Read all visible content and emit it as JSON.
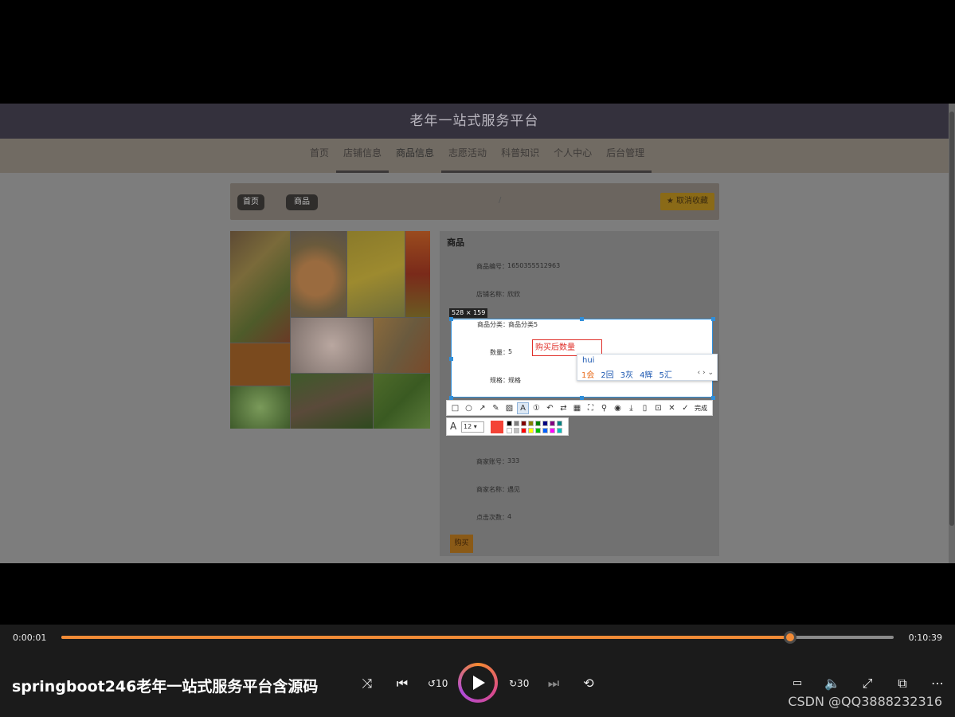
{
  "site": {
    "title": "老年一站式服务平台",
    "nav": [
      "首页",
      "店铺信息",
      "商品信息",
      "志愿活动",
      "科普知识",
      "个人中心",
      "后台管理"
    ],
    "active_nav": "商品信息"
  },
  "breadcrumb": {
    "home": "首页",
    "current": "商品"
  },
  "favorite_button": "取消收藏",
  "product": {
    "heading": "商品",
    "fields": [
      {
        "label": "商品编号：",
        "value": "1650355512963"
      },
      {
        "label": "店铺名称：",
        "value": "欣欣"
      },
      {
        "label": "商品分类：",
        "value": "商品分类5"
      },
      {
        "label": "数量：",
        "value": "5"
      },
      {
        "label": "规格：",
        "value": "规格"
      },
      {
        "label": "商家账号：",
        "value": "333"
      },
      {
        "label": "商家名称：",
        "value": "遇见"
      },
      {
        "label": "点击次数：",
        "value": "4"
      }
    ],
    "buy_button": "购买"
  },
  "capture": {
    "size_label": "528 × 159",
    "text_annotation": "购买后数量",
    "ime": {
      "pinyin": "hui",
      "candidates": [
        "1会",
        "2回",
        "3灰",
        "4辉",
        "5汇"
      ]
    },
    "toolbar_done": "完成",
    "font_size": "12",
    "current_color": "#f44336",
    "palette": [
      "#000000",
      "#808080",
      "#800000",
      "#808000",
      "#008000",
      "#000080",
      "#800080",
      "#008080",
      "#ffffff",
      "#c0c0c0",
      "#ff0000",
      "#ffff00",
      "#00c000",
      "#0060ff",
      "#ff00ff",
      "#00c0c0"
    ]
  },
  "player": {
    "current_time": "0:00:01",
    "total_time": "0:10:39",
    "progress_percent": 87.6,
    "title": "springboot246老年一站式服务平台含源码",
    "watermark": "CSDN @QQ3888232316"
  }
}
